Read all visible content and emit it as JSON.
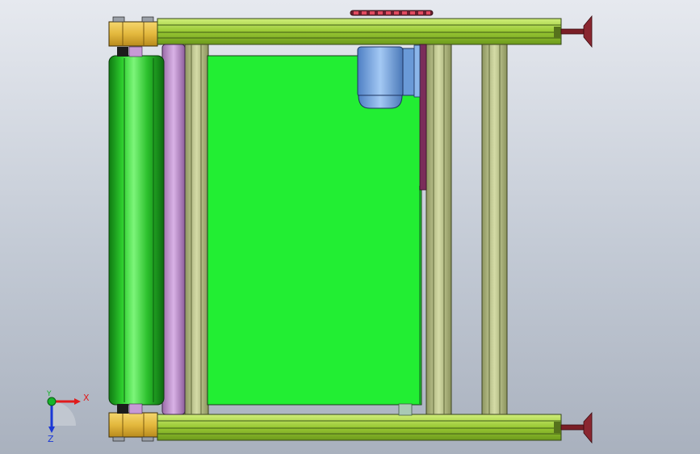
{
  "triad": {
    "x_label": "X",
    "y_label": "Y",
    "z_label": "Z",
    "x_color": "#e01b1b",
    "y_color": "#17b52a",
    "z_color": "#1b38d6"
  },
  "model": {
    "conveyor_belt_color": "#22ee33",
    "profile_rail_color": "#a4d33a",
    "frame_bar_color": "#c4cc95",
    "bearing_block_color": "#e3b83d",
    "drive_roller_color": "#2fd12f",
    "idler_roller_color": "#c79ad6",
    "motor_color": "#7fb0ec",
    "leveling_foot_color": "#7a1e26",
    "chain_color": "#c2324a"
  }
}
